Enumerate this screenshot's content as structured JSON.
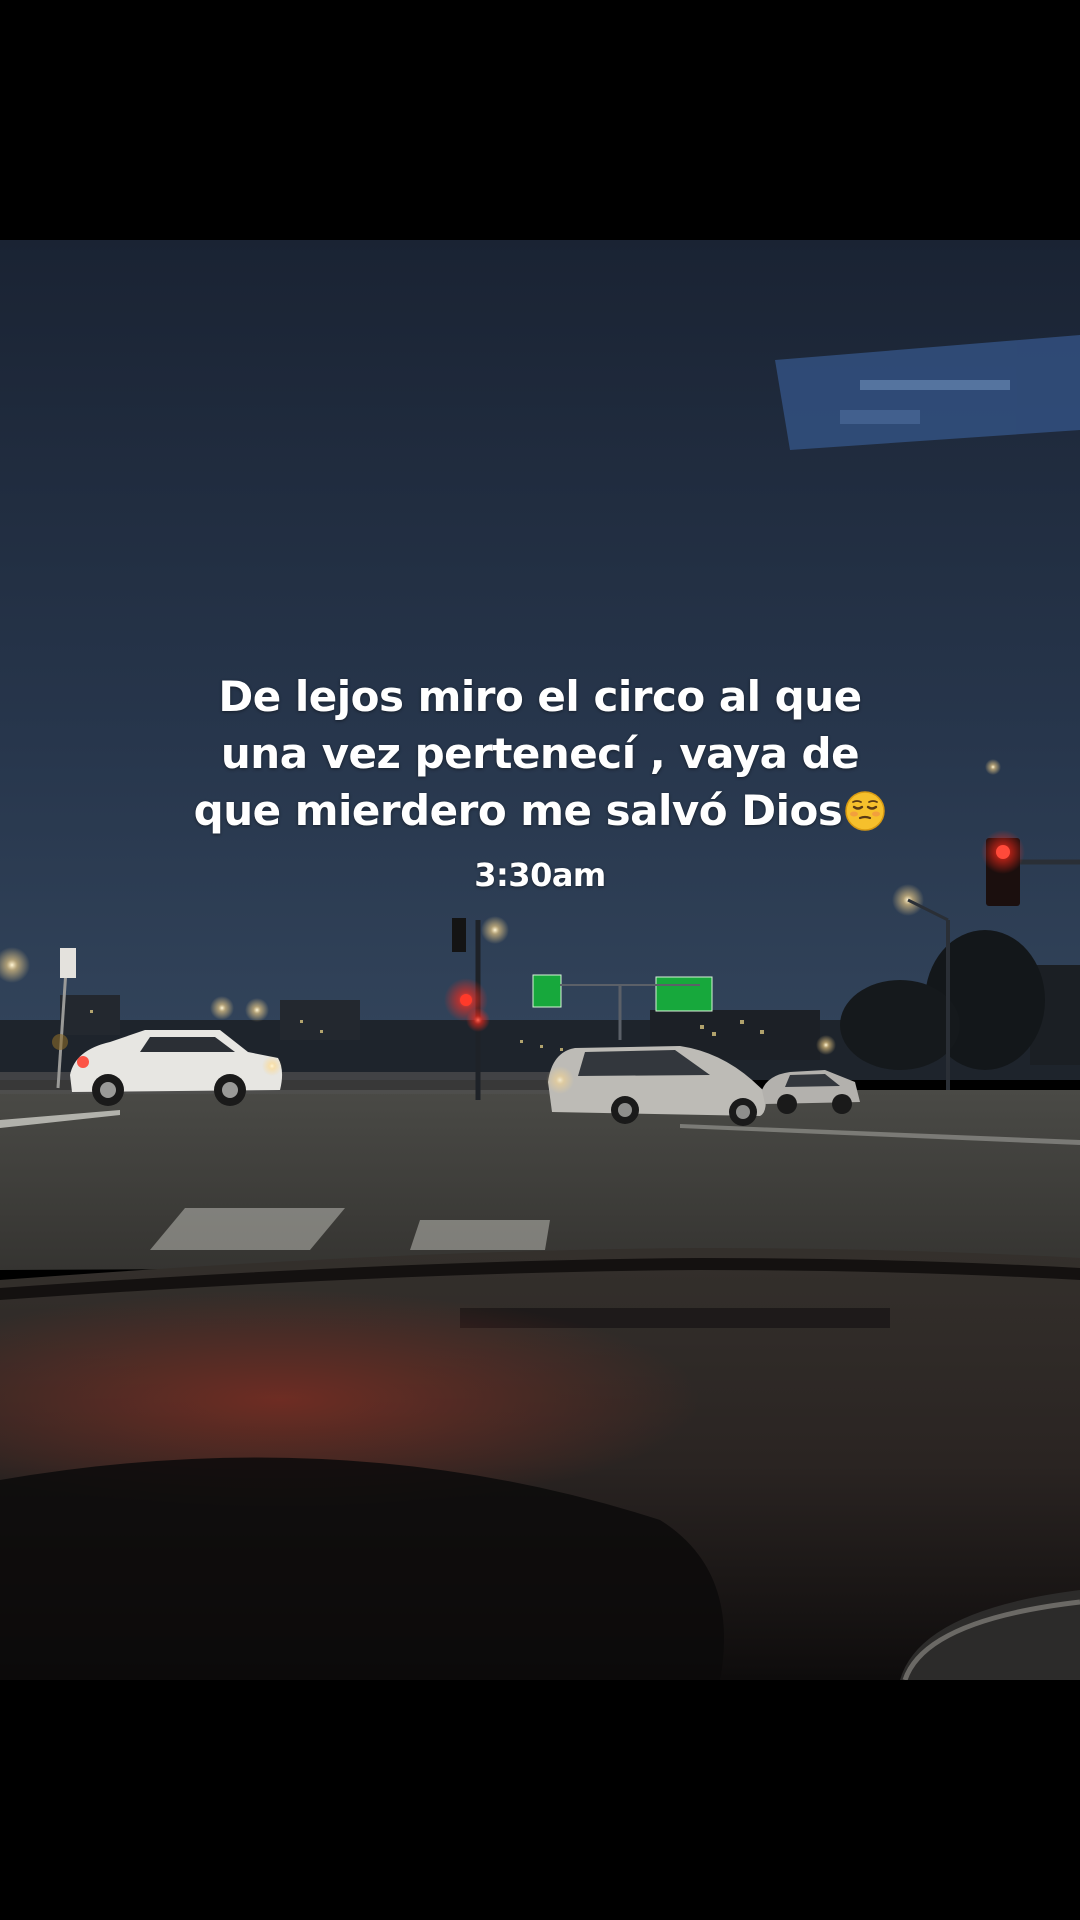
{
  "caption": {
    "line1": "De lejos miro el circo al que",
    "line2": "una vez pertenecí , vaya de",
    "line3": "que mierdero me salvó Dios",
    "emoji": "relieved-face-icon"
  },
  "time_label": "3:30am",
  "colors": {
    "letterbox": "#000000",
    "sky_top": "#1a2535",
    "sky_bottom": "#2e4058",
    "road": "#3c3c38",
    "dashboard": "#2a2320",
    "traffic_light_red": "#ff2a1a",
    "highway_sign": "#17a83c",
    "caption_text": "#ffffff"
  }
}
